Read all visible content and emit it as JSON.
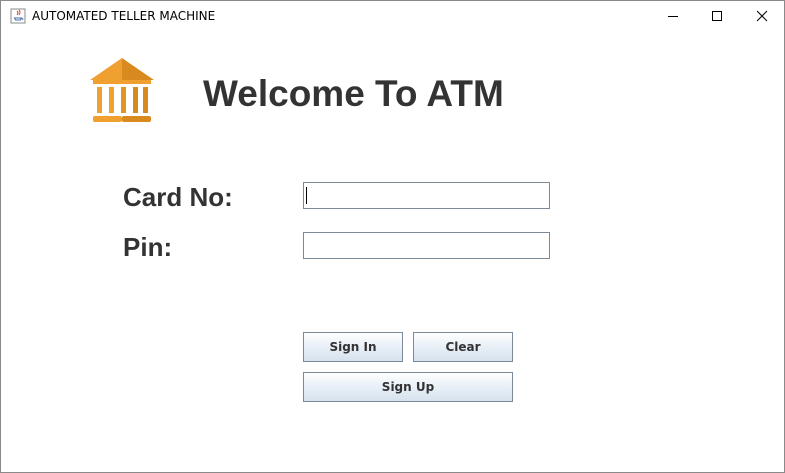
{
  "window": {
    "title": "AUTOMATED TELLER MACHINE",
    "icons": {
      "app": "java-cup-icon",
      "minimize": "minimize-icon",
      "maximize": "maximize-icon",
      "close": "close-icon"
    }
  },
  "header": {
    "logo_icon": "bank-icon",
    "title": "Welcome To ATM"
  },
  "form": {
    "card_label": "Card No:",
    "card_value": "",
    "pin_label": "Pin:",
    "pin_value": ""
  },
  "buttons": {
    "sign_in": "Sign In",
    "clear": "Clear",
    "sign_up": "Sign Up"
  },
  "colors": {
    "logo_light": "#F0A030",
    "logo_dark": "#D98A1E",
    "text": "#333333"
  }
}
